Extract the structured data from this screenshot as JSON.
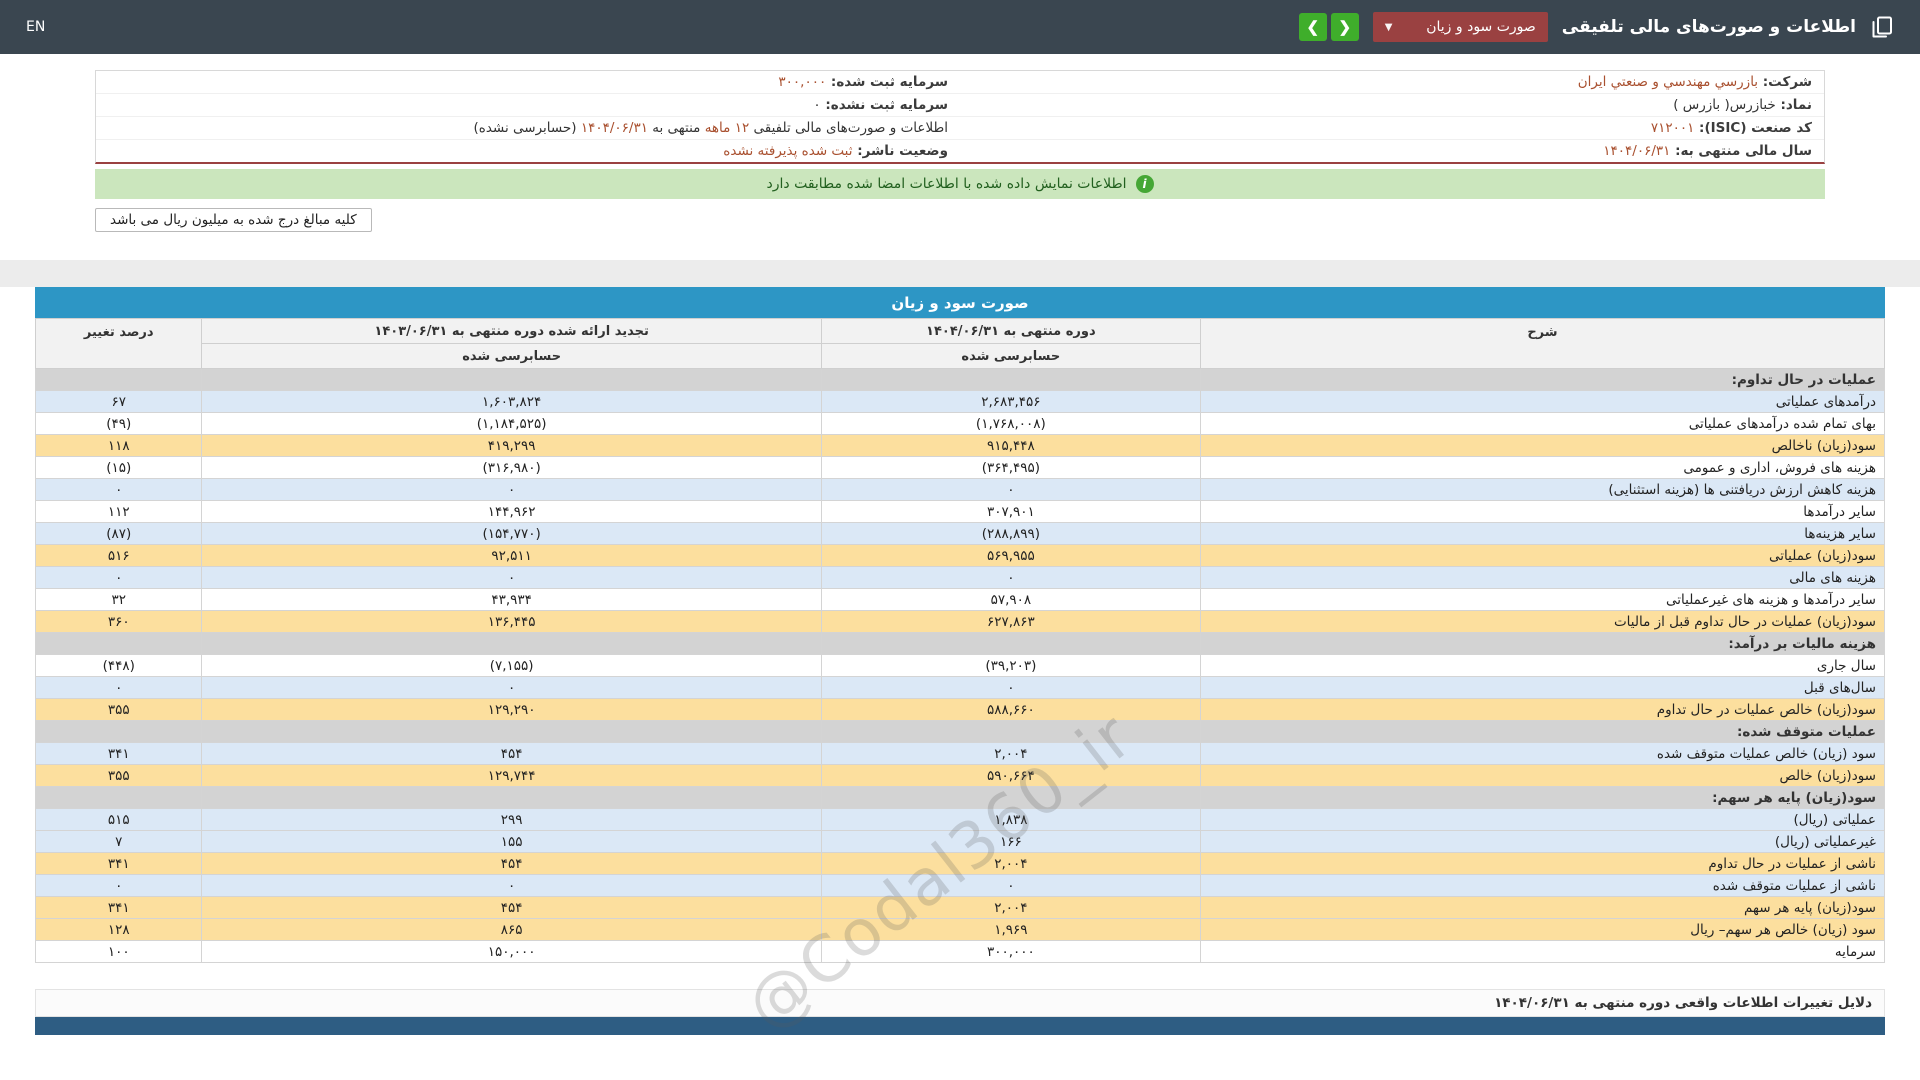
{
  "topbar": {
    "title": "اطلاعات و صورت‌های مالی تلفیقی",
    "statement_select": {
      "value": "صورت سود و زیان",
      "caret": "▼"
    },
    "nav_prev": "❮",
    "nav_next": "❯",
    "language": "EN"
  },
  "info": {
    "rows": [
      {
        "right": {
          "label": "شرکت:",
          "parts": [
            {
              "t": "بازرسي مهندسي و صنعتي ايران",
              "em": true
            }
          ]
        },
        "left": {
          "label": "سرمایه ثبت شده:",
          "parts": [
            {
              "t": "۳۰۰,۰۰۰",
              "em": true
            }
          ]
        }
      },
      {
        "right": {
          "label": "نماد:",
          "parts": [
            {
              "t": "خبازرس( بازرس )",
              "em": false
            }
          ]
        },
        "left": {
          "label": "سرمایه ثبت نشده:",
          "parts": [
            {
              "t": "۰",
              "em": false
            }
          ]
        }
      },
      {
        "right": {
          "label": "کد صنعت (ISIC):",
          "parts": [
            {
              "t": "۷۱۲۰۰۱",
              "em": true
            }
          ]
        },
        "left": {
          "label": "",
          "parts": [
            {
              "t": "اطلاعات و صورت‌های مالی تلفیقی ",
              "em": false
            },
            {
              "t": "۱۲ ماهه",
              "em": true
            },
            {
              "t": " منتهی به ",
              "em": false
            },
            {
              "t": "۱۴۰۴/۰۶/۳۱",
              "em": true
            },
            {
              "t": " (حسابرسی نشده)",
              "em": false
            }
          ]
        }
      },
      {
        "right": {
          "label": "سال مالی منتهی به:",
          "parts": [
            {
              "t": "۱۴۰۴/۰۶/۳۱",
              "em": true
            }
          ]
        },
        "left": {
          "label": "وضعیت ناشر:",
          "parts": [
            {
              "t": "ثبت شده پذیرفته نشده",
              "em": true
            }
          ]
        }
      }
    ]
  },
  "banner": {
    "icon": "i",
    "text": "اطلاعات نمایش داده شده با اطلاعات امضا شده مطابقت دارد"
  },
  "units_note": "کلیه مبالغ درج شده به میلیون ریال می باشد",
  "table": {
    "title": "صورت سود و زیان",
    "columns": {
      "desc": "شرح",
      "current": "دوره منتهی به ۱۴۰۴/۰۶/۳۱",
      "prior": "تجدید ارائه شده دوره منتهی به ۱۴۰۳/۰۶/۳۱",
      "audited_current": "حسابرسی شده",
      "audited_prior": "حسابرسی شده",
      "change": "درصد تغییر"
    },
    "rows": [
      {
        "label": "عملیات در حال تداوم:",
        "values": [
          "",
          "",
          ""
        ],
        "style": "section"
      },
      {
        "label": "درآمدهای عملیاتی",
        "values": [
          "۲,۶۸۳,۴۵۶",
          "۱,۶۰۳,۸۲۴",
          "۶۷"
        ],
        "style": "blue"
      },
      {
        "label": "بهای تمام شده درآمدهای عملیاتی",
        "values": [
          "(۱,۷۶۸,۰۰۸)",
          "(۱,۱۸۴,۵۲۵)",
          "(۴۹)"
        ],
        "style": "white"
      },
      {
        "label": "سود(زیان) ناخالص",
        "values": [
          "۹۱۵,۴۴۸",
          "۴۱۹,۲۹۹",
          "۱۱۸"
        ],
        "style": "yellow"
      },
      {
        "label": "هزینه های فروش، اداری و عمومی",
        "values": [
          "(۳۶۴,۴۹۵)",
          "(۳۱۶,۹۸۰)",
          "(۱۵)"
        ],
        "style": "white"
      },
      {
        "label": "هزینه کاهش ارزش دریافتنی ها (هزینه استثنایی)",
        "values": [
          "۰",
          "۰",
          "۰"
        ],
        "style": "blue"
      },
      {
        "label": "سایر درآمدها",
        "values": [
          "۳۰۷,۹۰۱",
          "۱۴۴,۹۶۲",
          "۱۱۲"
        ],
        "style": "white"
      },
      {
        "label": "سایر هزینه‌ها",
        "values": [
          "(۲۸۸,۸۹۹)",
          "(۱۵۴,۷۷۰)",
          "(۸۷)"
        ],
        "style": "blue"
      },
      {
        "label": "سود(زیان) عملیاتی",
        "values": [
          "۵۶۹,۹۵۵",
          "۹۲,۵۱۱",
          "۵۱۶"
        ],
        "style": "yellow"
      },
      {
        "label": "هزینه های مالی",
        "values": [
          "۰",
          "۰",
          "۰"
        ],
        "style": "blue"
      },
      {
        "label": "سایر درآمدها و هزینه های غیرعملیاتی",
        "values": [
          "۵۷,۹۰۸",
          "۴۳,۹۳۴",
          "۳۲"
        ],
        "style": "white"
      },
      {
        "label": "سود(زیان) عملیات در حال تداوم قبل از مالیات",
        "values": [
          "۶۲۷,۸۶۳",
          "۱۳۶,۴۴۵",
          "۳۶۰"
        ],
        "style": "yellow"
      },
      {
        "label": "هزینه مالیات بر درآمد:",
        "values": [
          "",
          "",
          ""
        ],
        "style": "section"
      },
      {
        "label": "سال جاری",
        "values": [
          "(۳۹,۲۰۳)",
          "(۷,۱۵۵)",
          "(۴۴۸)"
        ],
        "style": "white"
      },
      {
        "label": "سال‌های قبل",
        "values": [
          "۰",
          "۰",
          "۰"
        ],
        "style": "blue"
      },
      {
        "label": "سود(زیان) خالص عملیات در حال تداوم",
        "values": [
          "۵۸۸,۶۶۰",
          "۱۲۹,۲۹۰",
          "۳۵۵"
        ],
        "style": "yellow"
      },
      {
        "label": "عملیات متوقف شده:",
        "values": [
          "",
          "",
          ""
        ],
        "style": "section"
      },
      {
        "label": "سود (زیان) خالص عملیات متوقف شده",
        "values": [
          "۲,۰۰۴",
          "۴۵۴",
          "۳۴۱"
        ],
        "style": "blue"
      },
      {
        "label": "سود(زیان) خالص",
        "values": [
          "۵۹۰,۶۶۴",
          "۱۲۹,۷۴۴",
          "۳۵۵"
        ],
        "style": "yellow"
      },
      {
        "label": "سود(زیان) پایه هر سهم:",
        "values": [
          "",
          "",
          ""
        ],
        "style": "section"
      },
      {
        "label": "عملیاتی (ریال)",
        "values": [
          "۱,۸۳۸",
          "۲۹۹",
          "۵۱۵"
        ],
        "style": "blue"
      },
      {
        "label": "غیرعملیاتی (ریال)",
        "values": [
          "۱۶۶",
          "۱۵۵",
          "۷"
        ],
        "style": "blue"
      },
      {
        "label": "ناشی از عملیات در حال تداوم",
        "values": [
          "۲,۰۰۴",
          "۴۵۴",
          "۳۴۱"
        ],
        "style": "yellow"
      },
      {
        "label": "ناشی از عملیات متوقف شده",
        "values": [
          "۰",
          "۰",
          "۰"
        ],
        "style": "blue"
      },
      {
        "label": "سود(زیان) پایه هر سهم",
        "values": [
          "۲,۰۰۴",
          "۴۵۴",
          "۳۴۱"
        ],
        "style": "yellow"
      },
      {
        "label": "سود (زیان) خالص هر سهم– ریال",
        "values": [
          "۱,۹۶۹",
          "۸۶۵",
          "۱۲۸"
        ],
        "style": "yellow"
      },
      {
        "label": "سرمایه",
        "values": [
          "۳۰۰,۰۰۰",
          "۱۵۰,۰۰۰",
          "۱۰۰"
        ],
        "style": "white"
      }
    ]
  },
  "footer": {
    "reasons_title": "دلایل تغییرات اطلاعات واقعی دوره منتهی به ۱۴۰۴/۰۶/۳۱"
  },
  "watermark": "@Codal360_ir",
  "colors": {
    "topbar_bg": "#3a4650",
    "select_bg": "#9a4141",
    "nav_green": "#3fae2b",
    "banner_green": "#cbe6bd",
    "table_header_blue": "#2d96c5",
    "row_blue": "#dbe8f6",
    "row_yellow": "#fcdf9e",
    "row_section_gray": "#d3d3d3",
    "negative_red": "#d40000",
    "accent_maroon": "#a9502f",
    "footer_bar_blue": "#2e5d83"
  }
}
